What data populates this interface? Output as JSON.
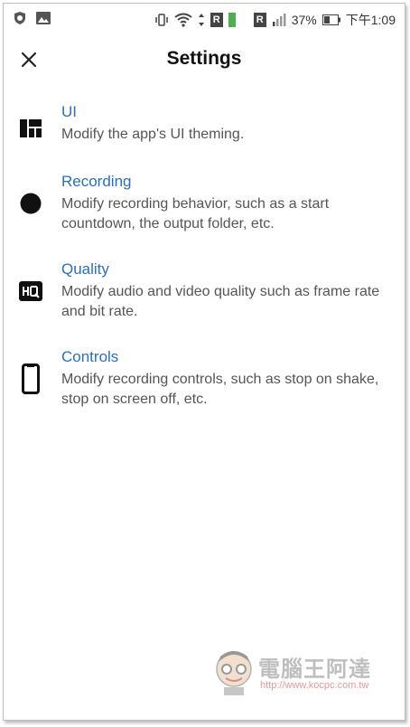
{
  "status_bar": {
    "r_badge_1": "R",
    "r_badge_2": "R",
    "battery": "37%",
    "time": "下午1:09"
  },
  "toolbar": {
    "title": "Settings",
    "close_icon": "close-icon"
  },
  "settings": [
    {
      "icon": "layout-dashboard-icon",
      "title": "UI",
      "desc": "Modify the app's UI theming."
    },
    {
      "icon": "record-dot-icon",
      "title": "Recording",
      "desc": "Modify recording behavior, such as a start countdown, the output folder, etc."
    },
    {
      "icon": "hq-icon",
      "title": "Quality",
      "desc": "Modify audio and video quality such as frame rate and bit rate."
    },
    {
      "icon": "phone-icon",
      "title": "Controls",
      "desc": "Modify recording controls, such as stop on shake, stop on screen off, etc."
    }
  ],
  "watermark": {
    "title": "電腦王阿達",
    "url": "http://www.kocpc.com.tw"
  },
  "colors": {
    "accent": "#2a6fbd",
    "text": "#111111",
    "secondary": "#555555"
  }
}
